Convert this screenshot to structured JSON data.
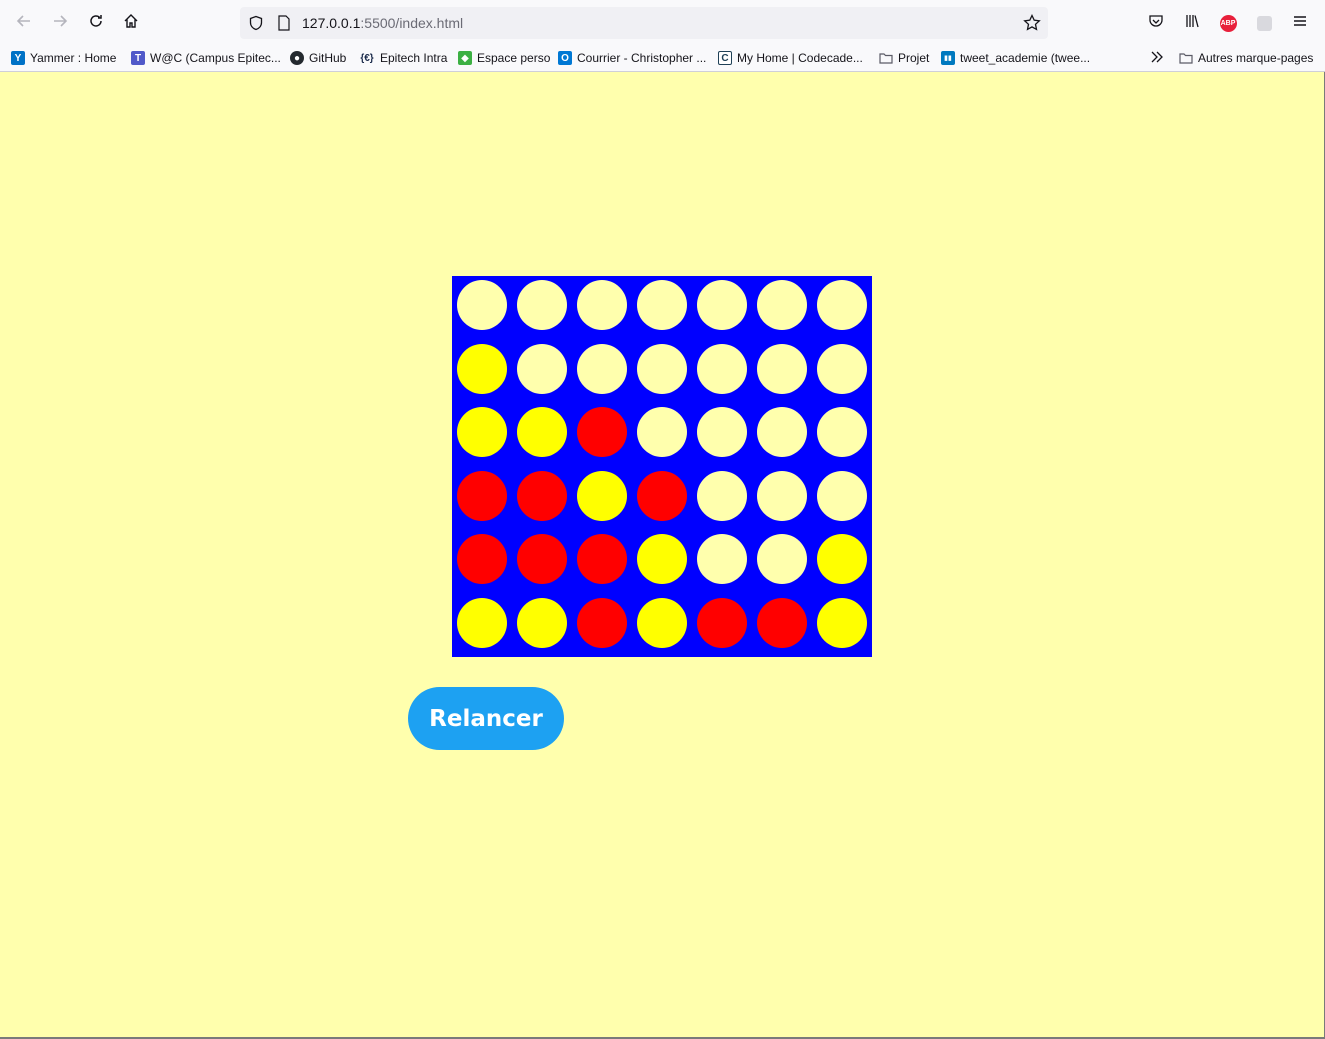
{
  "browser": {
    "url_host": "127.0.0.1",
    "url_rest": ":5500/index.html",
    "bookmarks": [
      {
        "label": "Yammer : Home",
        "icon": "yammer-icon",
        "color": "#0072c6",
        "glyph": "Y"
      },
      {
        "label": "W@C (Campus Epitec...",
        "icon": "teams-icon",
        "color": "#5059c9",
        "glyph": "T"
      },
      {
        "label": "GitHub",
        "icon": "github-icon",
        "color": "#24292e",
        "glyph": "●"
      },
      {
        "label": "Epitech Intra",
        "icon": "epitech-icon",
        "color": "#1a2a4a",
        "glyph": "{€}"
      },
      {
        "label": "Espace perso",
        "icon": "espace-perso-icon",
        "color": "#3cb043",
        "glyph": "◆"
      },
      {
        "label": "Courrier - Christopher ...",
        "icon": "outlook-icon",
        "color": "#0078d4",
        "glyph": "O"
      },
      {
        "label": "My Home | Codecade...",
        "icon": "codecademy-icon",
        "color": "#1f4056",
        "glyph": "C"
      },
      {
        "label": "Projet",
        "icon": "folder-icon",
        "color": "#5b5b66",
        "glyph": ""
      },
      {
        "label": "tweet_academie (twee...",
        "icon": "trello-icon",
        "color": "#0079bf",
        "glyph": "▮▮"
      }
    ],
    "other_bookmarks": "Autres marque-pages",
    "abp_label": "ABP"
  },
  "game": {
    "colors": {
      "board": "#0000ff",
      "empty": "#ffffad",
      "yellow": "#ffff00",
      "red": "#ff0000",
      "button": "#1da1f2"
    },
    "rows": 6,
    "cols": 7,
    "grid": [
      [
        "empty",
        "empty",
        "empty",
        "empty",
        "empty",
        "empty",
        "empty"
      ],
      [
        "yellow",
        "empty",
        "empty",
        "empty",
        "empty",
        "empty",
        "empty"
      ],
      [
        "yellow",
        "yellow",
        "red",
        "empty",
        "empty",
        "empty",
        "empty"
      ],
      [
        "red",
        "red",
        "yellow",
        "red",
        "empty",
        "empty",
        "empty"
      ],
      [
        "red",
        "red",
        "red",
        "yellow",
        "empty",
        "empty",
        "yellow"
      ],
      [
        "yellow",
        "yellow",
        "red",
        "yellow",
        "red",
        "red",
        "yellow"
      ]
    ],
    "restart_label": "Relancer"
  }
}
